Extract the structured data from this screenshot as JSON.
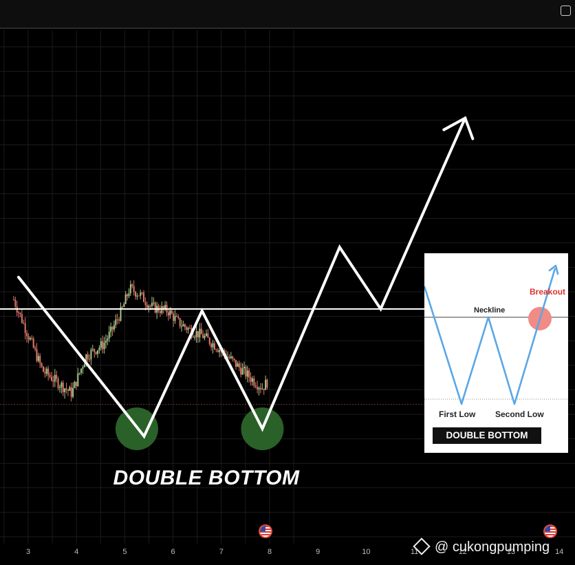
{
  "pattern_title": "DOUBLE BOTTOM",
  "inset": {
    "neckline_label": "Neckline",
    "breakout_label": "Breakout",
    "first_low_label": "First Low",
    "second_low_label": "Second Low",
    "badge": "DOUBLE BOTTOM"
  },
  "watermark": {
    "text": "@ cukongpumping",
    "icon": "binance-square-icon"
  },
  "colors": {
    "background": "#000000",
    "up_candle": "#a7c98a",
    "down_candle": "#e0796b",
    "pattern_line": "#ffffff",
    "bottom_marker": "#2f6b2c",
    "inset_line": "#5aa6e6",
    "breakout_marker": "#f08b86"
  },
  "chart_data": {
    "type": "line",
    "x_tick_labels": [
      "3",
      "4",
      "5",
      "6",
      "7",
      "8",
      "9",
      "10",
      "11",
      "12",
      "13",
      "14"
    ],
    "series": [
      {
        "values": [
          [
            2.7,
            0.8
          ],
          [
            3.3,
            0.42
          ],
          [
            3.9,
            0.3
          ],
          [
            4.2,
            0.5
          ],
          [
            4.55,
            0.56
          ],
          [
            4.7,
            0.62
          ],
          [
            4.95,
            0.75
          ],
          [
            5.1,
            0.86
          ],
          [
            5.3,
            0.83
          ],
          [
            5.55,
            0.76
          ],
          [
            5.9,
            0.74
          ],
          [
            6.1,
            0.68
          ],
          [
            6.4,
            0.63
          ],
          [
            6.6,
            0.61
          ],
          [
            6.9,
            0.55
          ],
          [
            7.2,
            0.48
          ],
          [
            7.4,
            0.43
          ],
          [
            7.7,
            0.36
          ],
          [
            7.85,
            0.33
          ],
          [
            7.95,
            0.36
          ]
        ]
      }
    ],
    "pattern_path": [
      [
        2.8,
        0.92
      ],
      [
        5.4,
        0.07
      ],
      [
        6.6,
        0.74
      ],
      [
        7.85,
        0.11
      ],
      [
        9.45,
        1.08
      ],
      [
        10.3,
        0.75
      ],
      [
        12.05,
        1.77
      ]
    ],
    "neckline": 0.75,
    "support_level": 0.24,
    "bottoms": [
      [
        5.25,
        0.11
      ],
      [
        7.85,
        0.11
      ]
    ]
  }
}
